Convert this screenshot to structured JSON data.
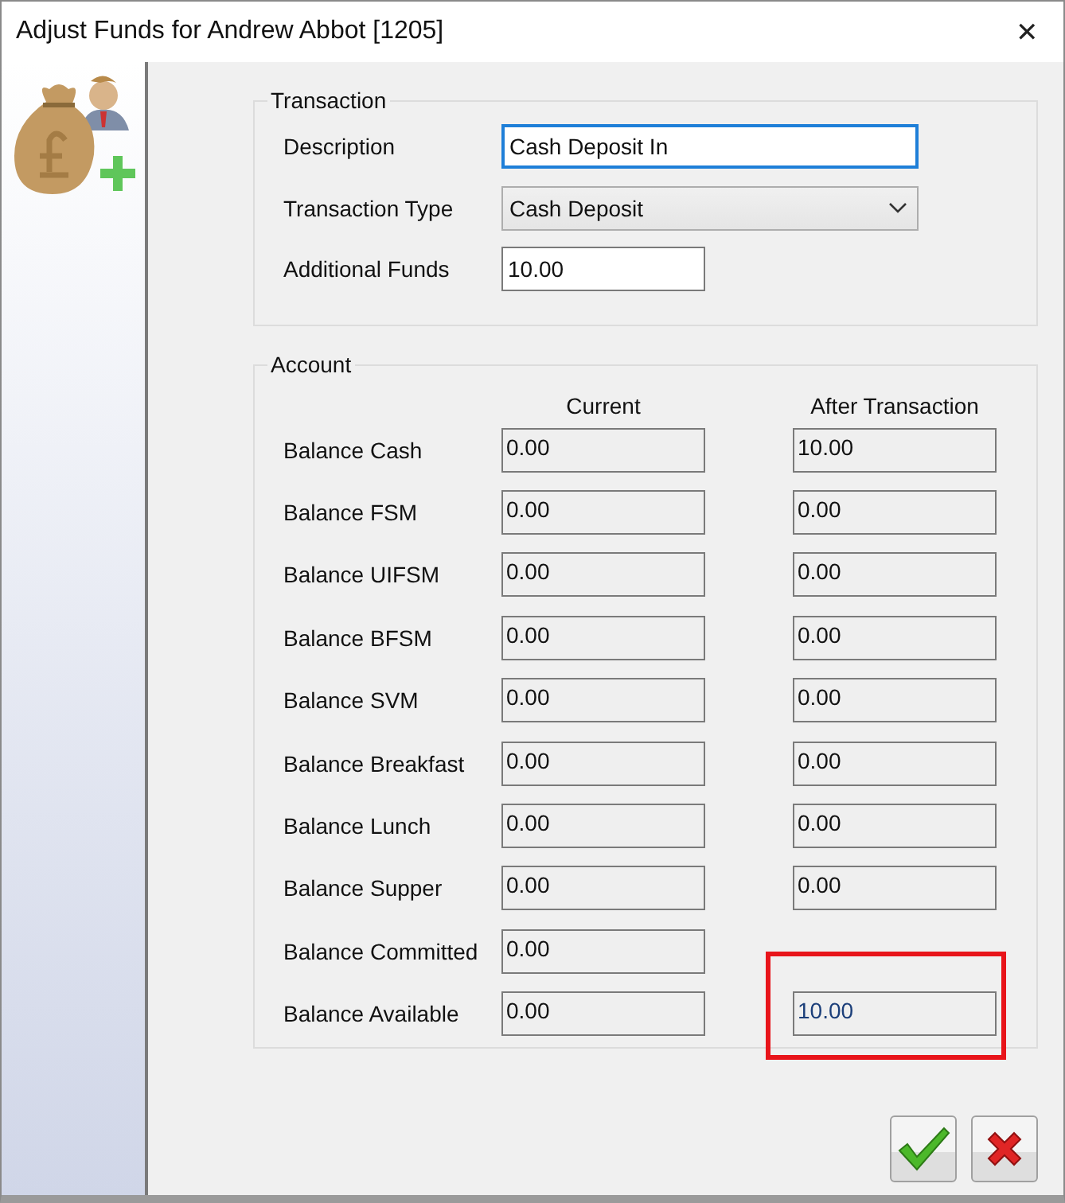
{
  "window": {
    "title": "Adjust Funds for Andrew Abbot [1205]",
    "close": "✕"
  },
  "transaction": {
    "legend": "Transaction",
    "fields": [
      {
        "label": "Description",
        "kind": "text",
        "value": "Cash Deposit In",
        "focused": true
      },
      {
        "label": "Transaction Type",
        "kind": "dropdown",
        "value": "Cash Deposit",
        "focused": false
      },
      {
        "label": "Additional Funds",
        "kind": "short",
        "value": "10.00",
        "focused": false
      }
    ]
  },
  "account": {
    "legend": "Account",
    "columns": [
      "Current",
      "After Transaction"
    ],
    "rows": [
      {
        "label": "Balance Cash",
        "current": "0.00",
        "after": "10.00",
        "highlighted": false
      },
      {
        "label": "Balance FSM",
        "current": "0.00",
        "after": "0.00",
        "highlighted": false
      },
      {
        "label": "Balance UIFSM",
        "current": "0.00",
        "after": "0.00",
        "highlighted": false
      },
      {
        "label": "Balance BFSM",
        "current": "0.00",
        "after": "0.00",
        "highlighted": false
      },
      {
        "label": "Balance SVM",
        "current": "0.00",
        "after": "0.00",
        "highlighted": false
      },
      {
        "label": "Balance Breakfast",
        "current": "0.00",
        "after": "0.00",
        "highlighted": false
      },
      {
        "label": "Balance Lunch",
        "current": "0.00",
        "after": "0.00",
        "highlighted": false
      },
      {
        "label": "Balance Supper",
        "current": "0.00",
        "after": "0.00",
        "highlighted": false
      },
      {
        "label": "Balance Committed",
        "current": "0.00",
        "highlighted": false
      },
      {
        "label": "Balance Available",
        "current": "0.00",
        "after": "10.00",
        "highlighted": true
      }
    ]
  }
}
